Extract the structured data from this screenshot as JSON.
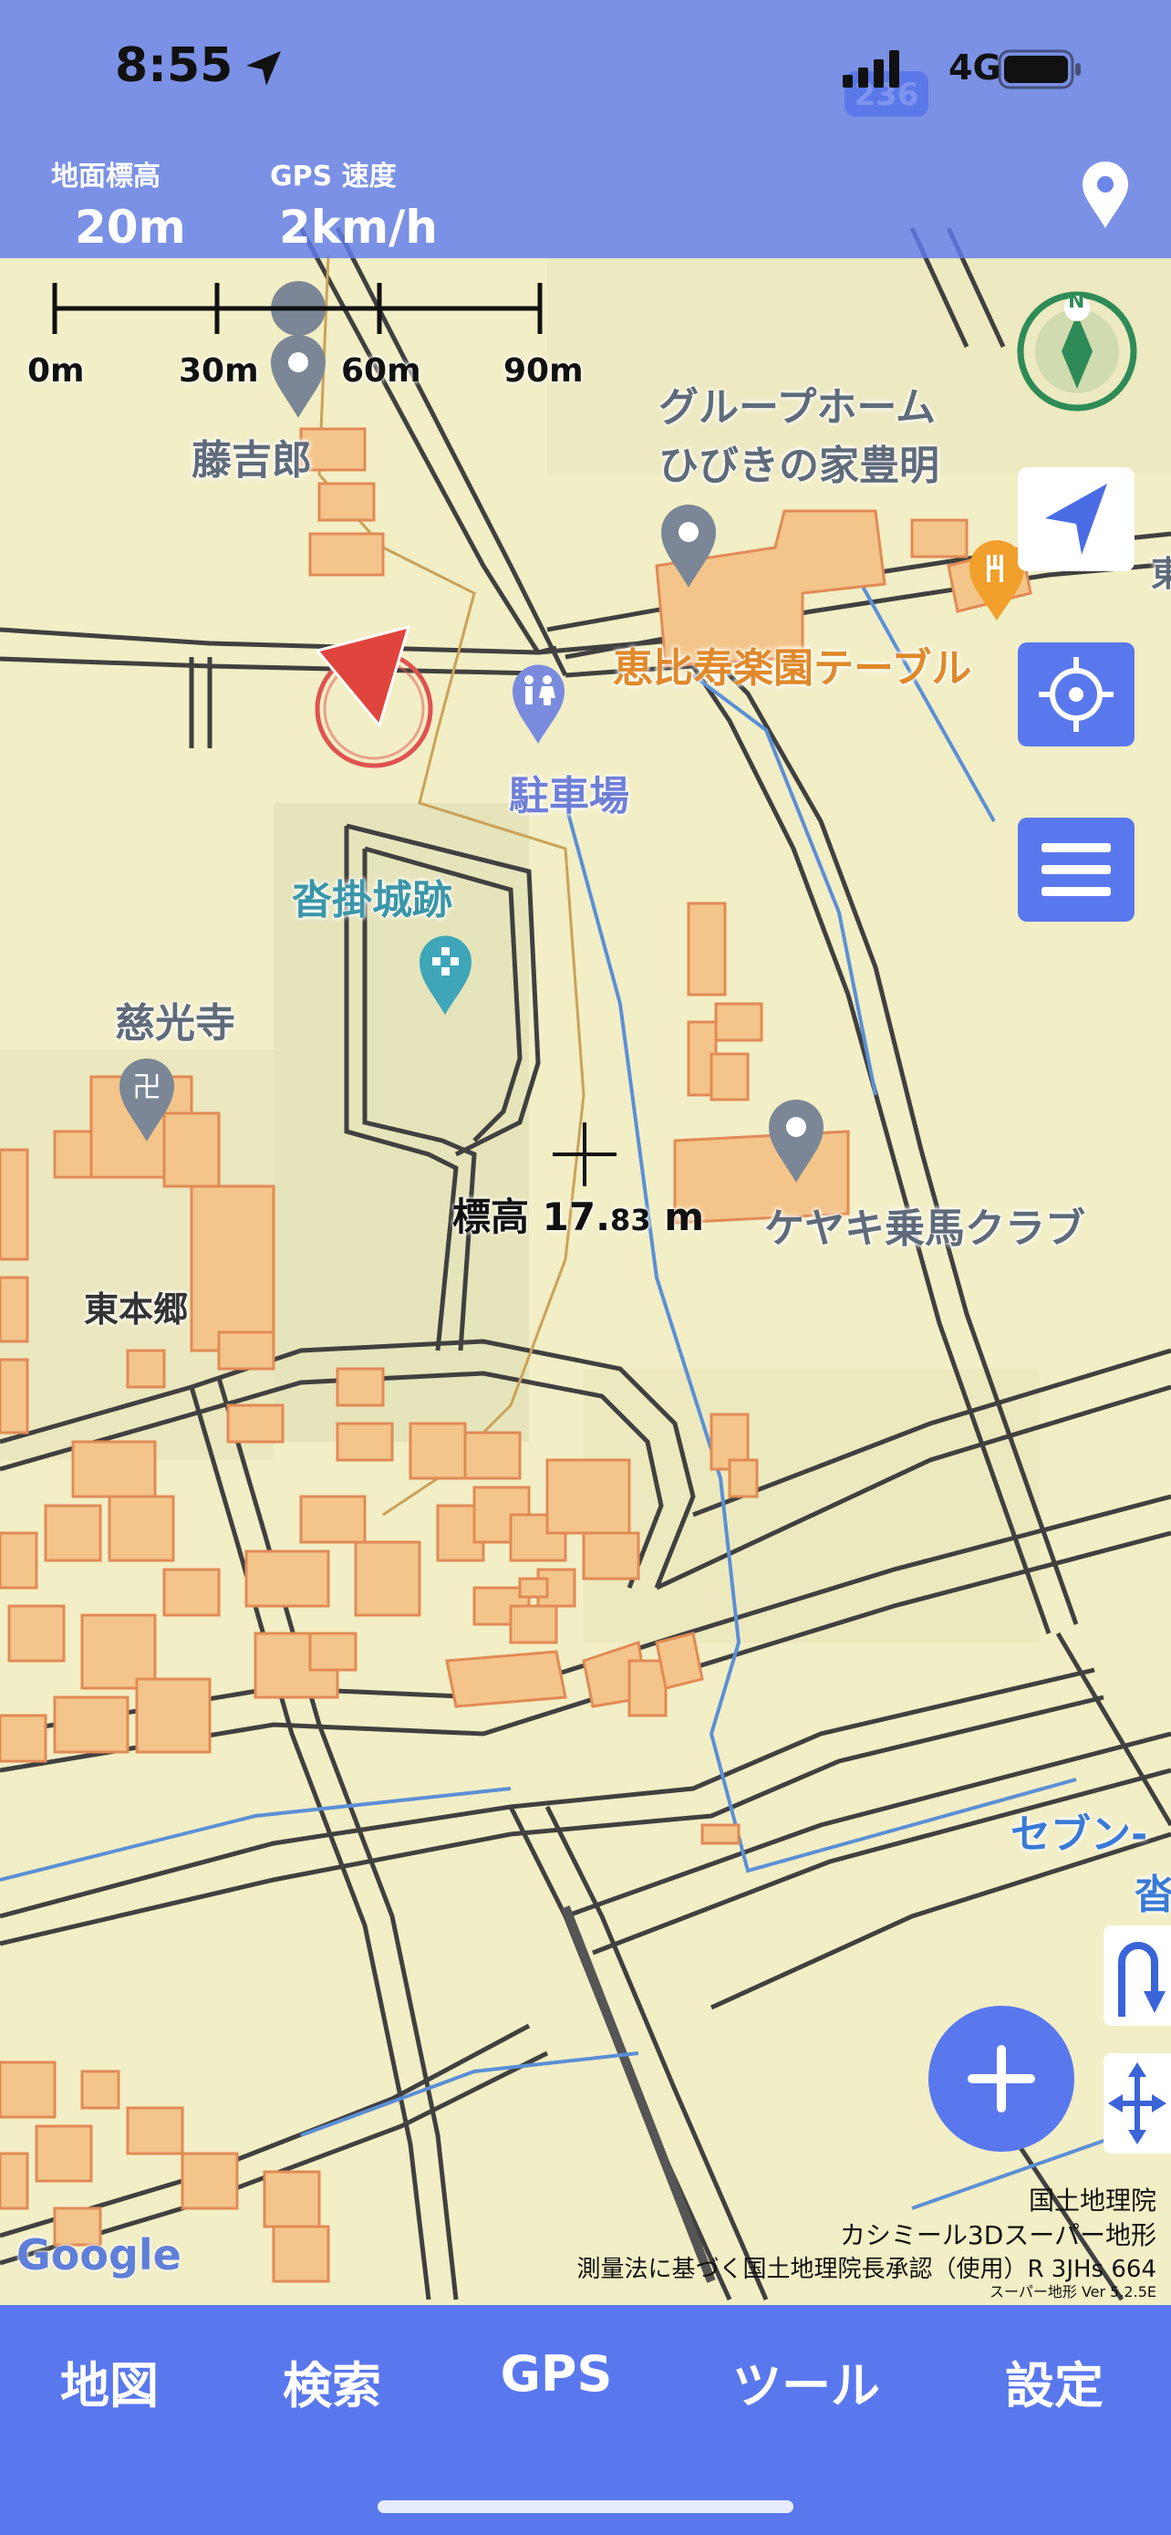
{
  "status_bar": {
    "time": "8:55",
    "network": "4G"
  },
  "header": {
    "elevation_label": "地面標高",
    "elevation_value": "20m",
    "gps_speed_label": "GPS 速度",
    "gps_speed_value": "2km/h"
  },
  "scale_bar": {
    "ticks": [
      "0m",
      "30m",
      "60m",
      "90m"
    ]
  },
  "map": {
    "road_sign": "236",
    "labels": {
      "fujikichiro": "藤吉郎",
      "group_home_1": "グループホーム",
      "group_home_2": "ひびきの家豊明",
      "ebisu": "恵比寿楽園テーブル",
      "parking": "駐車場",
      "castle_ruins": "沓掛城跡",
      "jikoji": "慈光寺",
      "higashi_hongo": "東本郷",
      "keyaki": "ケヤキ乗馬クラブ",
      "seven_1": "セブン-",
      "seven_2": "沓",
      "edge_kanji": "東"
    },
    "crosshair_elevation": {
      "prefix": "標高",
      "int_part": "17.",
      "dec_part": "83",
      "unit": "m"
    },
    "compass_letter": "N",
    "attribution": {
      "line1": "国土地理院",
      "line2": "カシミール3Dスーパー地形",
      "line3": "測量法に基づく国土地理院長承認（使用）R 3JHs 664",
      "line4": "スーパー地形 Ver 5.2.5E"
    },
    "google_logo": "Google"
  },
  "bottom_nav": {
    "items": [
      "地図",
      "検索",
      "GPS",
      "ツール",
      "設定"
    ]
  },
  "colors": {
    "accent": "#5a78ee",
    "map_bg": "#f3efc6",
    "building": "#f2c58a",
    "road": "#3a3a3a"
  }
}
